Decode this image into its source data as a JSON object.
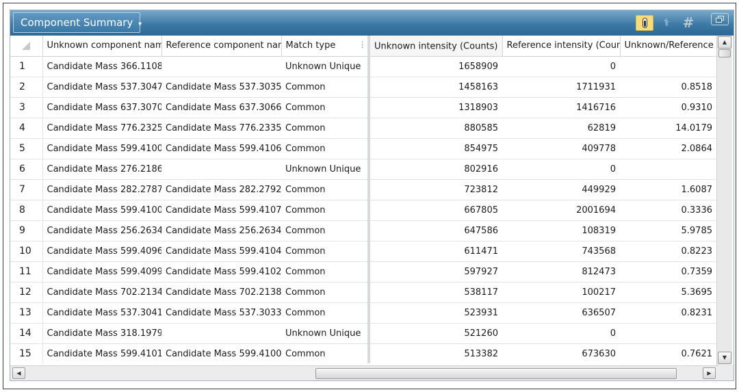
{
  "panel": {
    "title": "Component Summary",
    "title_caret": "▾",
    "toolbar_icons": [
      "thermometer-icon",
      "stethoscope-icon",
      "hash-icon",
      "restore-window-icon"
    ]
  },
  "table": {
    "columns": [
      "",
      "Unknown component name",
      "Reference component name",
      "Match type",
      "Unknown intensity (Counts)",
      "Reference intensity (Counts)",
      "Unknown/Reference"
    ],
    "sort_indicator": "1",
    "sort_arrow": "▼",
    "rows": [
      {
        "n": "1",
        "unknown": "Candidate Mass 366.1108",
        "reference": "",
        "match": "Unknown Unique",
        "u_int": "1658909",
        "r_int": "0",
        "ratio": ""
      },
      {
        "n": "2",
        "unknown": "Candidate Mass 537.3047",
        "reference": "Candidate Mass 537.3035",
        "match": "Common",
        "u_int": "1458163",
        "r_int": "1711931",
        "ratio": "0.8518"
      },
      {
        "n": "3",
        "unknown": "Candidate Mass 637.3070",
        "reference": "Candidate Mass 637.3066",
        "match": "Common",
        "u_int": "1318903",
        "r_int": "1416716",
        "ratio": "0.9310"
      },
      {
        "n": "4",
        "unknown": "Candidate Mass 776.2325",
        "reference": "Candidate Mass 776.2335",
        "match": "Common",
        "u_int": "880585",
        "r_int": "62819",
        "ratio": "14.0179"
      },
      {
        "n": "5",
        "unknown": "Candidate Mass 599.4100",
        "reference": "Candidate Mass 599.4106",
        "match": "Common",
        "u_int": "854975",
        "r_int": "409778",
        "ratio": "2.0864"
      },
      {
        "n": "6",
        "unknown": "Candidate Mass 276.2186",
        "reference": "",
        "match": "Unknown Unique",
        "u_int": "802916",
        "r_int": "0",
        "ratio": ""
      },
      {
        "n": "7",
        "unknown": "Candidate Mass 282.2787",
        "reference": "Candidate Mass 282.2792",
        "match": "Common",
        "u_int": "723812",
        "r_int": "449929",
        "ratio": "1.6087"
      },
      {
        "n": "8",
        "unknown": "Candidate Mass 599.4100",
        "reference": "Candidate Mass 599.4107",
        "match": "Common",
        "u_int": "667805",
        "r_int": "2001694",
        "ratio": "0.3336"
      },
      {
        "n": "9",
        "unknown": "Candidate Mass 256.2634",
        "reference": "Candidate Mass 256.2634",
        "match": "Common",
        "u_int": "647586",
        "r_int": "108319",
        "ratio": "5.9785"
      },
      {
        "n": "10",
        "unknown": "Candidate Mass 599.4096",
        "reference": "Candidate Mass 599.4104",
        "match": "Common",
        "u_int": "611471",
        "r_int": "743568",
        "ratio": "0.8223"
      },
      {
        "n": "11",
        "unknown": "Candidate Mass 599.4099",
        "reference": "Candidate Mass 599.4102",
        "match": "Common",
        "u_int": "597927",
        "r_int": "812473",
        "ratio": "0.7359"
      },
      {
        "n": "12",
        "unknown": "Candidate Mass 702.2134",
        "reference": "Candidate Mass 702.2138",
        "match": "Common",
        "u_int": "538117",
        "r_int": "100217",
        "ratio": "5.3695"
      },
      {
        "n": "13",
        "unknown": "Candidate Mass 537.3041",
        "reference": "Candidate Mass 537.3033",
        "match": "Common",
        "u_int": "523931",
        "r_int": "636507",
        "ratio": "0.8231"
      },
      {
        "n": "14",
        "unknown": "Candidate Mass 318.1979",
        "reference": "",
        "match": "Unknown Unique",
        "u_int": "521260",
        "r_int": "0",
        "ratio": ""
      },
      {
        "n": "15",
        "unknown": "Candidate Mass 599.4101",
        "reference": "Candidate Mass 599.4100",
        "match": "Common",
        "u_int": "513382",
        "r_int": "673630",
        "ratio": "0.7621"
      }
    ]
  },
  "colors": {
    "titlebar": "#3d7aa6",
    "active_tool": "#f7dd7a",
    "grid_lines": "#e3e3e3"
  }
}
